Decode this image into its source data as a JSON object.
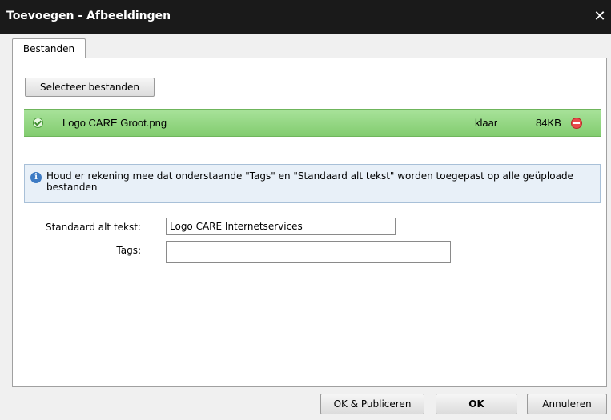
{
  "window": {
    "title": "Toevoegen - Afbeeldingen",
    "close_glyph": "✕"
  },
  "tabs": [
    {
      "label": "Bestanden"
    }
  ],
  "upload": {
    "select_button": "Selecteer bestanden",
    "files": [
      {
        "name": "Logo CARE Groot.png",
        "status": "klaar",
        "size": "84KB",
        "row_color": "#8fd37e"
      }
    ]
  },
  "info": {
    "message": "Houd er rekening mee dat onderstaande \"Tags\" en \"Standaard alt tekst\" worden toegepast op alle geüploade bestanden",
    "icon": "info-icon"
  },
  "form": {
    "alt_label": "Standaard alt tekst:",
    "alt_value": "Logo CARE Internetservices",
    "tags_label": "Tags:",
    "tags_value": ""
  },
  "footer": {
    "publish_label": "OK & Publiceren",
    "ok_label": "OK",
    "cancel_label": "Annuleren"
  },
  "colors": {
    "titlebar": "#1a1a1a",
    "success_row": "#8fd37e",
    "info_bg": "#e8f0f8",
    "remove": "#e84a4a"
  }
}
